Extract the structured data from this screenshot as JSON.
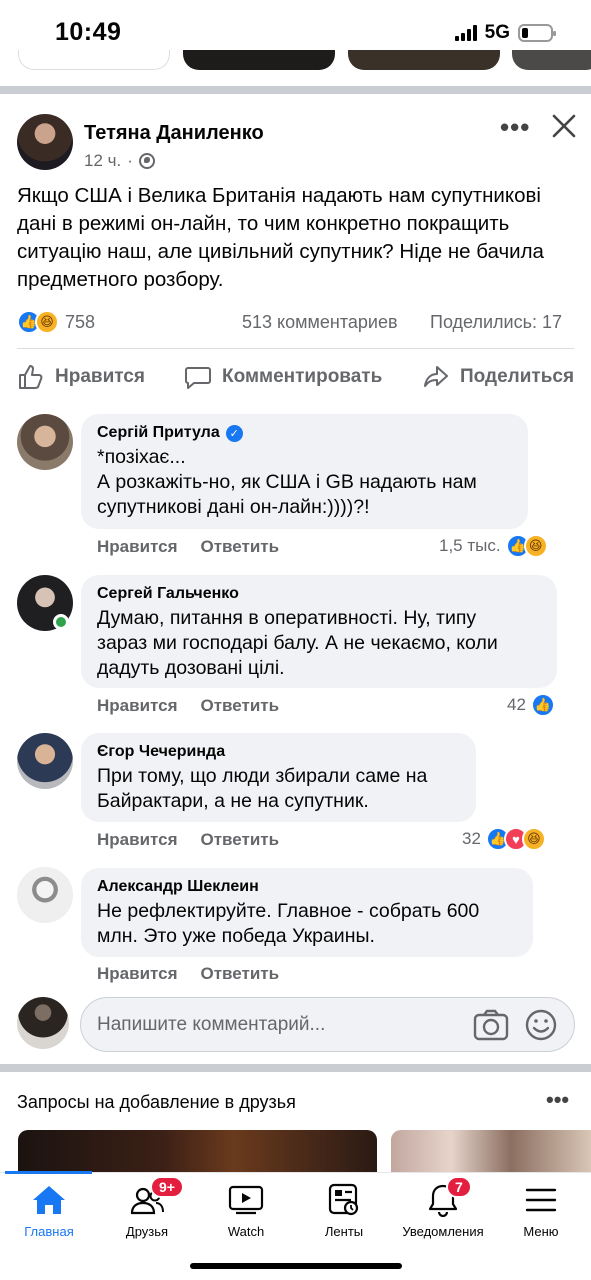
{
  "status_bar": {
    "time": "10:49",
    "network": "5G"
  },
  "post": {
    "author": "Тетяна Даниленко",
    "time": "12 ч.",
    "text": "Якщо США і Велика Британія надають нам супутникові дані в режимі он-лайн, то чим конкретно покращить ситуацію наш, але цивільний супутник? Ніде не бачила предметного розбору.",
    "reactions_count": "758",
    "comments_count": "513 комментариев",
    "shares_count": "Поделились: 17"
  },
  "actions": {
    "like": "Нравится",
    "comment": "Комментировать",
    "share": "Поделиться"
  },
  "comments": [
    {
      "name": "Сергій Притула",
      "verified": true,
      "text_lines": [
        "*позіхає...",
        "А розкажіть-но, як США і GB надають нам",
        "супутникові дані он-лайн:))))?!"
      ],
      "like": "Нравится",
      "reply": "Ответить",
      "reactions": "1,5 тыс."
    },
    {
      "name": "Сергей Гальченко",
      "text_lines": [
        "Думаю, питання в оперативності. Ну, типу",
        "зараз ми господарі балу. А не чекаємо, коли",
        "дадуть дозовані цілі."
      ],
      "like": "Нравится",
      "reply": "Ответить",
      "reactions": "42"
    },
    {
      "name": "Єгор Чечеринда",
      "text_lines": [
        "При тому, що люди збирали саме на",
        "Байрактари, а не на супутник."
      ],
      "like": "Нравится",
      "reply": "Ответить",
      "reactions": "32"
    },
    {
      "name": "Александр Шеклеин",
      "text_lines": [
        "Не рефлектируйте. Главное - собрать 600",
        "млн. Это уже победа Украины."
      ],
      "like": "Нравится",
      "reply": "Ответить"
    }
  ],
  "write_comment": {
    "placeholder": "Напишите комментарий..."
  },
  "friend_requests": {
    "title": "Запросы на добавление в друзья"
  },
  "bottom_nav": {
    "items": [
      {
        "label": "Главная",
        "icon": "home-icon"
      },
      {
        "label": "Друзья",
        "icon": "friends-icon",
        "badge": "9+"
      },
      {
        "label": "Watch",
        "icon": "watch-icon"
      },
      {
        "label": "Ленты",
        "icon": "feeds-icon"
      },
      {
        "label": "Уведомления",
        "icon": "bell-icon",
        "badge": "7"
      },
      {
        "label": "Меню",
        "icon": "menu-icon"
      }
    ]
  },
  "colors": {
    "accent": "#1877f2",
    "bubble": "#f0f2f5",
    "muted": "#65676b",
    "badge": "#e41e3f"
  }
}
